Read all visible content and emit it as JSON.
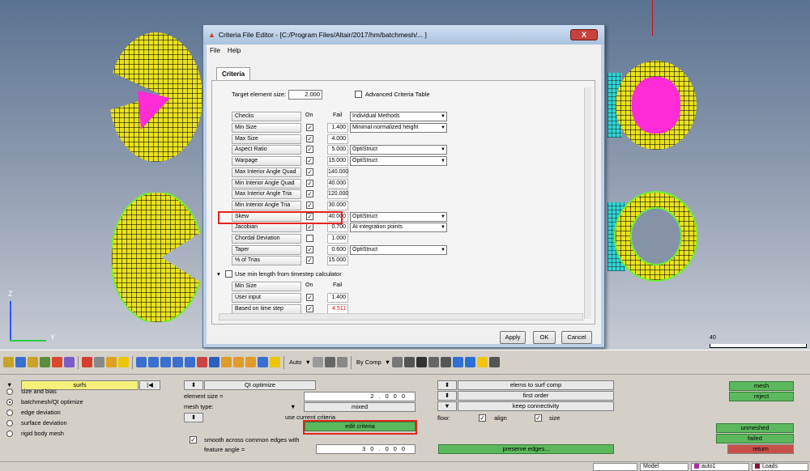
{
  "dialog": {
    "title": "Criteria File Editor - [C:/Program Files/Altair/2017/hm/batchmesh/... ]",
    "close_label": "X",
    "menu": [
      "File",
      "Help"
    ],
    "tab": "Criteria",
    "target_size_label": "Target element size:",
    "target_size_value": "2.000",
    "advanced_label": "Advanced Criteria Table",
    "headers": {
      "checks": "Checks",
      "on": "On",
      "fail": "Fail"
    },
    "rows": [
      {
        "name": "Min Size",
        "on": true,
        "fail": "1.400",
        "method": "Minimal normalized height",
        "dropdown": true
      },
      {
        "name": "Max Size",
        "on": true,
        "fail": "4.000",
        "method": "",
        "dropdown": false
      },
      {
        "name": "Aspect Ratio",
        "on": true,
        "fail": "5.000",
        "method": "OptiStruct",
        "dropdown": true
      },
      {
        "name": "Warpage",
        "on": true,
        "fail": "15.000",
        "method": "OptiStruct",
        "dropdown": true
      },
      {
        "name": "Max Interior Angle Quad",
        "on": true,
        "fail": "140.000",
        "method": "",
        "dropdown": false
      },
      {
        "name": "Min Interior Angle Quad",
        "on": true,
        "fail": "40.000",
        "method": "",
        "dropdown": false
      },
      {
        "name": "Max Interior Angle Tria",
        "on": true,
        "fail": "120.000",
        "method": "",
        "dropdown": false
      },
      {
        "name": "Min Interior Angle Tria",
        "on": true,
        "fail": "30.000",
        "method": "",
        "dropdown": false
      },
      {
        "name": "Skew",
        "on": true,
        "fail": "40.000",
        "method": "OptiStruct",
        "dropdown": true
      },
      {
        "name": "Jacobian",
        "on": true,
        "fail": "0.700",
        "method": "At integration points",
        "dropdown": true
      },
      {
        "name": "Chordal Deviation",
        "on": false,
        "fail": "1.000",
        "method": "",
        "dropdown": false
      },
      {
        "name": "Taper",
        "on": true,
        "fail": "0.600",
        "method": "OptiStruct",
        "dropdown": true
      },
      {
        "name": "% of Trias",
        "on": true,
        "fail": "15.000",
        "method": "",
        "dropdown": false
      }
    ],
    "checks_method": "Individual Methods",
    "timestep_label": "Use min length from timestep calculator",
    "ts_headers": {
      "name": "Min Size",
      "on": "On",
      "fail": "Fail"
    },
    "ts_rows": [
      {
        "name": "User input",
        "on": true,
        "fail": "1.400"
      },
      {
        "name": "Based on time step",
        "on": true,
        "fail": "4.511"
      }
    ],
    "buttons": {
      "apply": "Apply",
      "ok": "OK",
      "cancel": "Cancel"
    }
  },
  "viewport": {
    "axis_z": "Z",
    "axis_y": "Y",
    "scale": "40"
  },
  "toolbar": {
    "auto": "Auto",
    "bycomp": "By Comp"
  },
  "panel": {
    "tab_label": "surfs",
    "tab_arrow": "|◀",
    "radios": [
      {
        "label": "size and bias",
        "on": false
      },
      {
        "label": "batchmesh/QI optimize",
        "on": true
      },
      {
        "label": "edge deviation",
        "on": false
      },
      {
        "label": "surface deviation",
        "on": false
      },
      {
        "label": "rigid body mesh",
        "on": false
      }
    ],
    "qi_optimize": "QI optimize",
    "element_size_label": "element size  =",
    "element_size_value": "2.000",
    "mesh_type_label": "mesh type:",
    "mesh_type_value": "mixed",
    "use_current_criteria": "use current criteria",
    "edit_criteria": "edit criteria",
    "smooth_label": "smooth across common edges with",
    "feature_angle_label": "feature angle =",
    "feature_angle_value": "30.000",
    "elems_to_surf": "elems to surf comp",
    "first_order": "first order",
    "keep_connectivity": "keep connectivity",
    "flow_label": "flow:",
    "align_label": "align",
    "size_label": "size",
    "preserve_edges": "preserve edges...",
    "mesh": "mesh",
    "reject": "reject",
    "unmeshed": "unmeshed",
    "failed": "failed",
    "return": "return"
  },
  "status": {
    "model": "Model",
    "auto": "auto1",
    "loads": "Loads"
  },
  "colors": {
    "accent_green": "#5cb85c",
    "highlight_red": "#e3251f",
    "mesh_yellow": "#e9e21e",
    "magenta": "#ff2bd6"
  }
}
